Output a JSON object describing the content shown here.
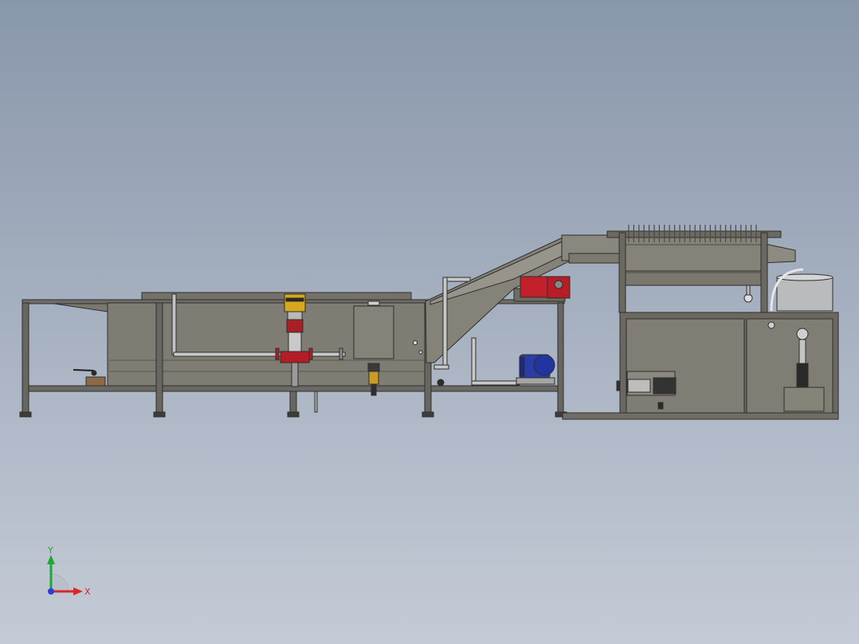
{
  "viewport": {
    "background_top": "#8997ab",
    "background_bottom": "#c4cbd6"
  },
  "model": {
    "frame_color": "#5f5e5a",
    "body_color": "#7d7a72",
    "motor_red": "#c8202a",
    "motor_blue": "#2a3fa8",
    "pump_yellow": "#d8a81c"
  },
  "triad": {
    "x_label": "X",
    "y_label": "Y",
    "x_color": "#d42a2a",
    "y_color": "#1fa83a",
    "z_color": "#2a3fd4"
  }
}
